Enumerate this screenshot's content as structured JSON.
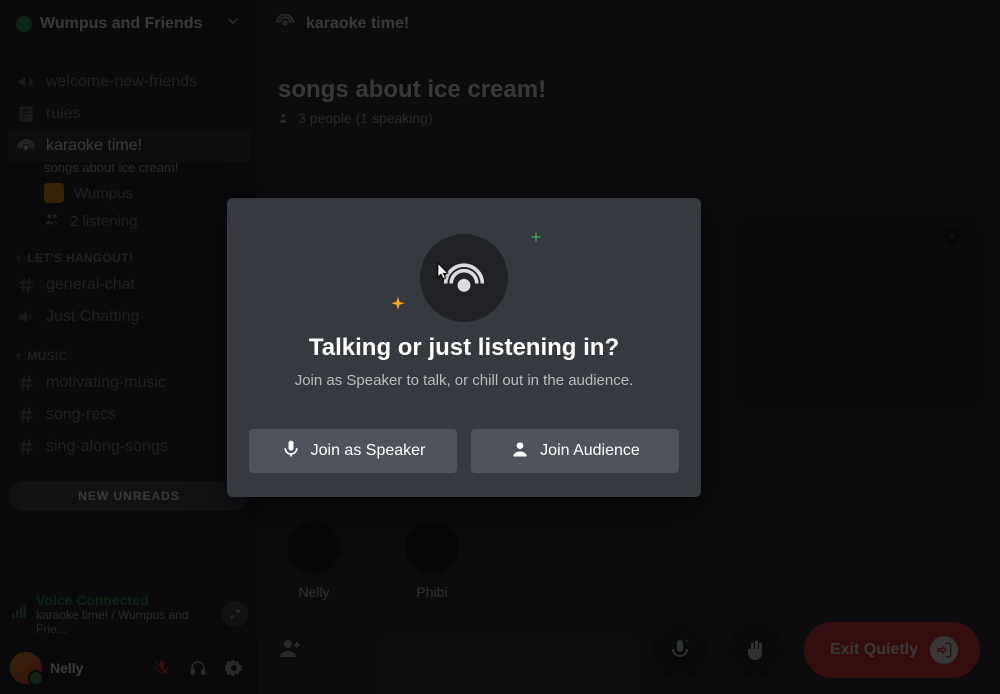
{
  "server": {
    "name": "Wumpus and Friends"
  },
  "sidebar": {
    "channels_top": [
      {
        "label": "welcome-new-friends"
      },
      {
        "label": "rules"
      }
    ],
    "stage": {
      "label": "karaoke time!",
      "topic": "songs about ice cream!",
      "speaker": "Wumpus",
      "listening_label": "2 listening"
    },
    "section_hangout": "LET'S HANGOUT!",
    "hangout_channels": [
      {
        "label": "general-chat"
      },
      {
        "label": "Just Chatting",
        "voice": true
      }
    ],
    "section_music": "MUSIC",
    "music_channels": [
      {
        "label": "motivating-music"
      },
      {
        "label": "song-recs"
      },
      {
        "label": "sing-along-songs"
      }
    ],
    "new_unreads": "NEW UNREADS"
  },
  "voice_panel": {
    "title": "Voice Connected",
    "sub": "karaoke time! / Wumpus and Frie..."
  },
  "user": {
    "name": "Nelly"
  },
  "header": {
    "channel": "karaoke time!"
  },
  "stage_area": {
    "title": "songs about ice cream!",
    "sub": "3 people (1 speaking)",
    "members": [
      {
        "name": "Nelly"
      },
      {
        "name": "Phibi"
      }
    ]
  },
  "footer": {
    "exit_label": "Exit Quietly"
  },
  "modal": {
    "title": "Talking or just listening in?",
    "desc": "Join as Speaker to talk, or chill out in the audience.",
    "btn_speaker": "Join as Speaker",
    "btn_audience": "Join Audience"
  }
}
